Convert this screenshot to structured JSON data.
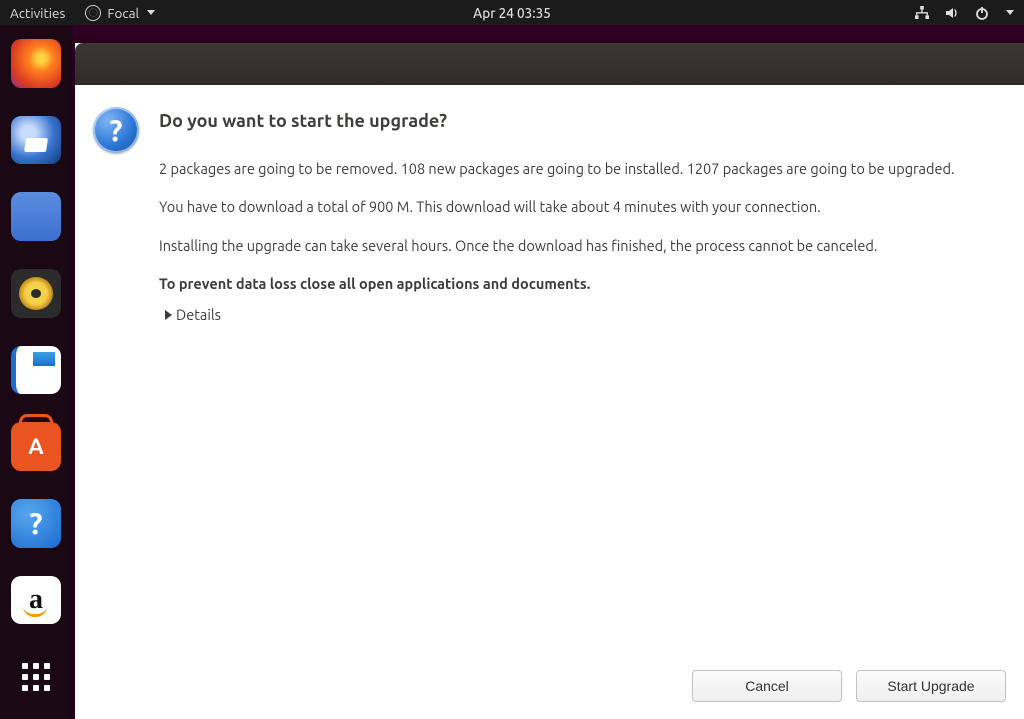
{
  "topbar": {
    "activities_label": "Activities",
    "app_label": "Focal",
    "clock": "Apr 24  03:35"
  },
  "dock": {
    "items": [
      {
        "name": "firefox"
      },
      {
        "name": "thunderbird"
      },
      {
        "name": "files"
      },
      {
        "name": "rhythmbox"
      },
      {
        "name": "libreoffice-writer"
      },
      {
        "name": "ubuntu-software"
      },
      {
        "name": "help"
      },
      {
        "name": "amazon"
      }
    ]
  },
  "dialog": {
    "heading": "Do you want to start the upgrade?",
    "para1": "2 packages are going to be removed. 108 new packages are going to be installed. 1207 packages are going to be upgraded.",
    "para2": "You have to download a total of 900 M. This download will take about 4 minutes with your connection.",
    "para3": "Installing the upgrade can take several hours. Once the download has finished, the process cannot be canceled.",
    "para_warning": "To prevent data loss close all open applications and documents.",
    "details_label": "Details",
    "buttons": {
      "cancel": "Cancel",
      "start": "Start Upgrade"
    }
  }
}
